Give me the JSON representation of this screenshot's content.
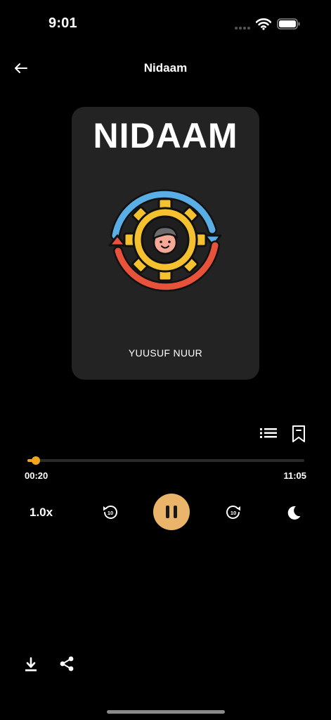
{
  "status_bar": {
    "time": "9:01"
  },
  "header": {
    "title": "Nidaam",
    "back_icon": "arrow-left-icon"
  },
  "cover": {
    "title": "NIDAAM",
    "author": "YUUSUF NUUR",
    "art_icon": "gear-person-cycle-icon"
  },
  "actions": {
    "chapters_icon": "list-icon",
    "bookmark_icon": "bookmark-icon"
  },
  "progress": {
    "elapsed": "00:20",
    "total": "11:05",
    "fraction": 0.03
  },
  "controls": {
    "speed": "1.0x",
    "rewind_seconds": "10",
    "forward_seconds": "10",
    "state": "playing"
  },
  "colors": {
    "background": "#000000",
    "card": "#232323",
    "accent": "#f0a71a",
    "play_button": "#eab56a"
  }
}
